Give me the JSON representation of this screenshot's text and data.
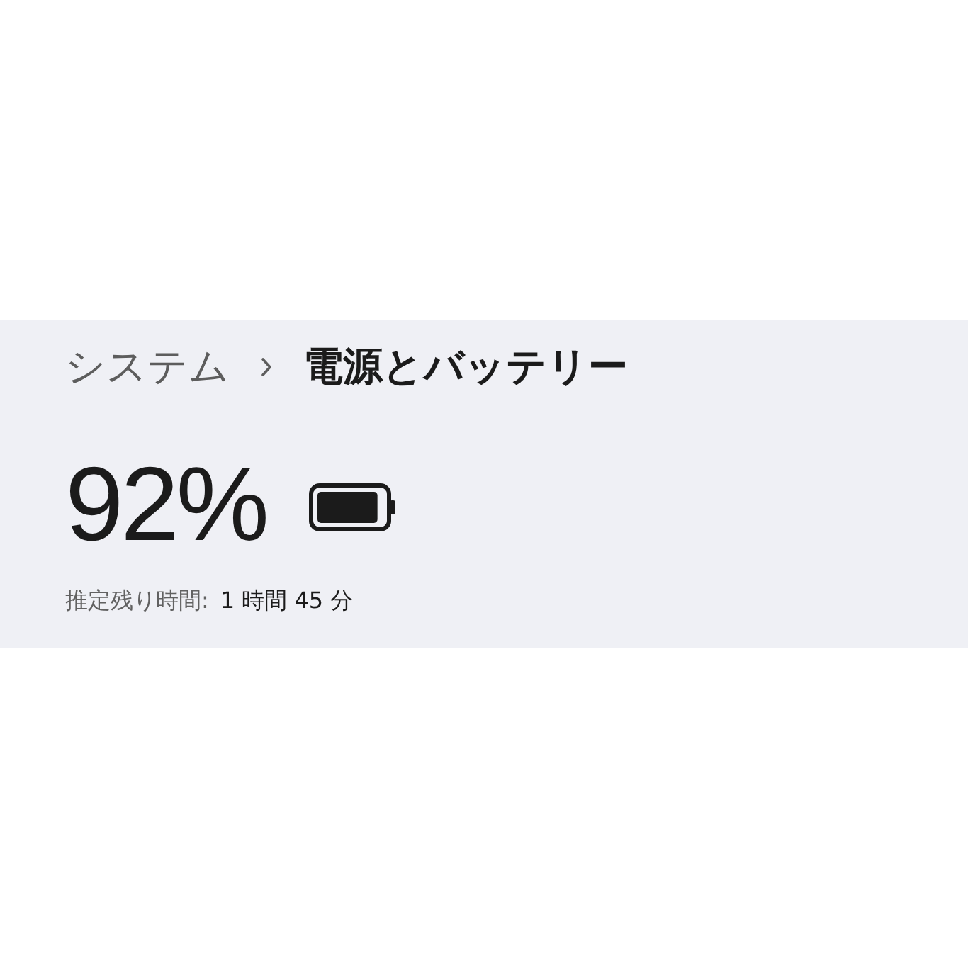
{
  "breadcrumb": {
    "parent": "システム",
    "current": "電源とバッテリー"
  },
  "battery": {
    "percent": "92%",
    "level": 0.92
  },
  "estimate": {
    "label": "推定残り時間:",
    "value": "1 時間 45 分"
  }
}
